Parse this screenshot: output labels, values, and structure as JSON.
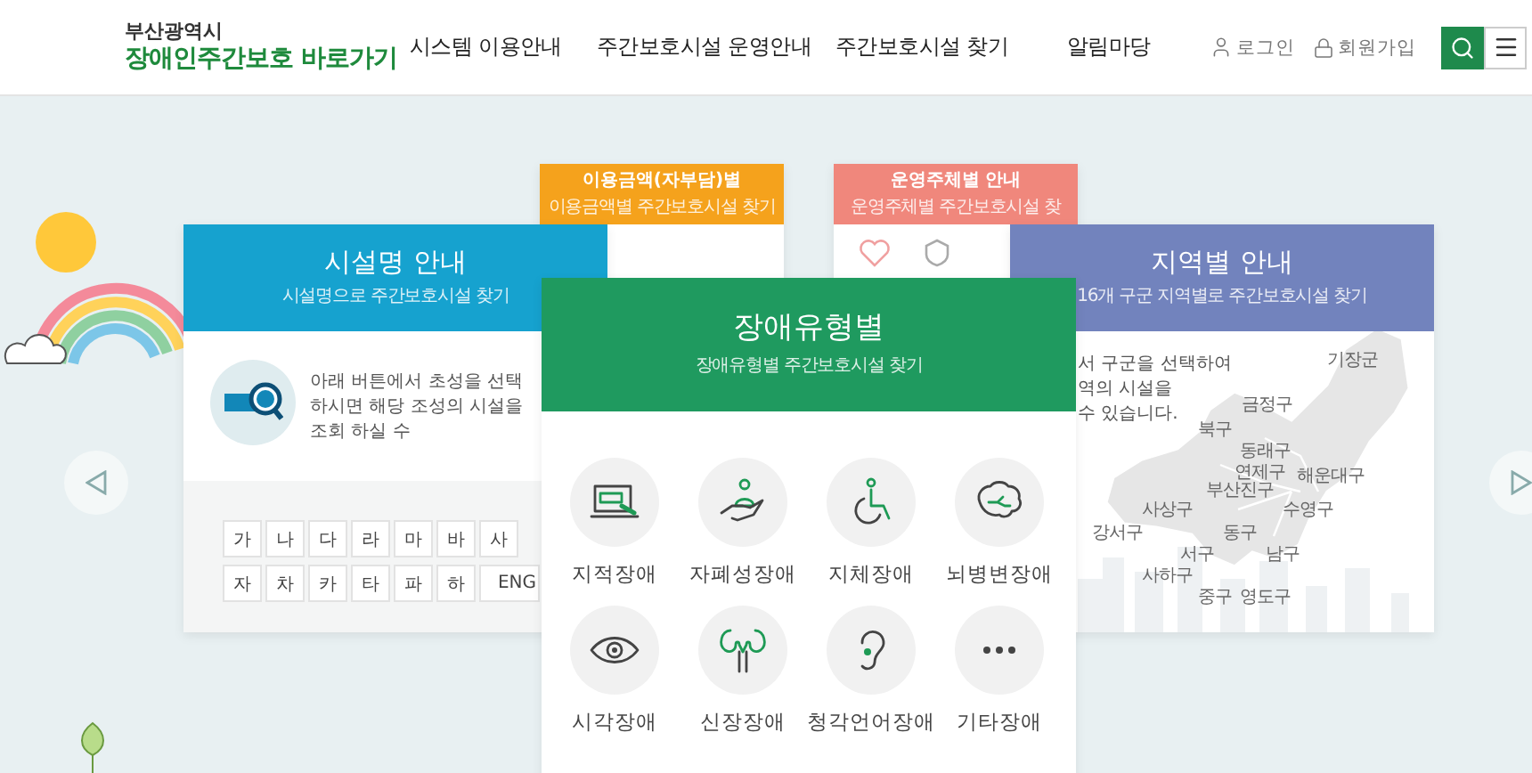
{
  "header": {
    "logo_top": "부산광역시",
    "logo_main": "장애인주간보호 바로가기",
    "nav": [
      "시스템 이용안내",
      "주간보호시설 운영안내",
      "주간보호시설 찾기",
      "알림마당"
    ],
    "login": "로그인",
    "signup": "회원가입"
  },
  "cards": {
    "fee": {
      "title": "이용금액(자부담)별",
      "subtitle": "이용금액별 주간보호시설 찾기"
    },
    "operator": {
      "title": "운영주체별 안내",
      "subtitle": "운영주체별 주간보호시설 찾"
    },
    "name": {
      "title": "시설명 안내",
      "subtitle": "시설명으로 주간보호시설 찾기",
      "description": "아래 버튼에서 초성을 선택하시면 해당 조성의 시설을 조회 하실 수",
      "keys": [
        [
          "가",
          "나",
          "다",
          "라",
          "마",
          "바",
          "사"
        ],
        [
          "자",
          "차",
          "카",
          "타",
          "파",
          "하",
          "ENG"
        ]
      ]
    },
    "region": {
      "title": "지역별 안내",
      "subtitle": "16개 구군 지역별로 주간보호시설 찾기",
      "description": [
        "서 구군을 선택하여",
        "역의 시설을",
        "수 있습니다."
      ],
      "districts": [
        "기장군",
        "금정구",
        "북구",
        "동래구",
        "연제구",
        "해운대구",
        "부산진구",
        "사상구",
        "수영구",
        "강서구",
        "동구",
        "서구",
        "남구",
        "사하구",
        "중구",
        "영도구"
      ]
    },
    "type": {
      "title": "장애유형별",
      "subtitle": "장애유형별 주간보호시설 찾기",
      "items": [
        {
          "label": "지적장애",
          "kind": "laptop"
        },
        {
          "label": "자폐성장애",
          "kind": "hand"
        },
        {
          "label": "지체장애",
          "kind": "wheelchair"
        },
        {
          "label": "뇌병변장애",
          "kind": "brain"
        },
        {
          "label": "시각장애",
          "kind": "eye"
        },
        {
          "label": "신장장애",
          "kind": "kidney"
        },
        {
          "label": "청각언어장애",
          "kind": "ear"
        },
        {
          "label": "기타장애",
          "kind": "dots"
        }
      ]
    }
  }
}
